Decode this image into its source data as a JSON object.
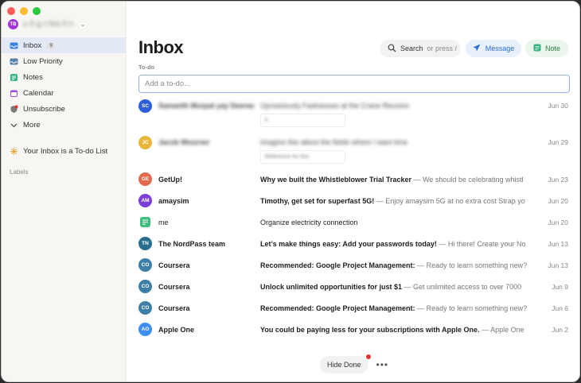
{
  "colors": {
    "accent": "#2c6cd6",
    "note": "#2e7d3d",
    "red_dot": "#e0312b"
  },
  "account": {
    "initials": "TB",
    "name": "u∙ll∙g∙t∙Ma∙ll∙n",
    "avatar_color": "#a334d9"
  },
  "sidebar": {
    "items": [
      {
        "label": "Inbox",
        "badge": "9",
        "icon": "inbox-icon"
      },
      {
        "label": "Low Priority",
        "icon": "low-priority-icon"
      },
      {
        "label": "Notes",
        "icon": "notes-icon"
      },
      {
        "label": "Calendar",
        "icon": "calendar-icon"
      },
      {
        "label": "Unsubscribe",
        "icon": "unsubscribe-icon"
      },
      {
        "label": "More",
        "icon": "chevron-down-icon"
      }
    ],
    "todo_hint": "Your Inbox is a To-do List",
    "labels_heading": "Labels"
  },
  "main": {
    "title": "Inbox",
    "todo_label": "To-do",
    "todo_placeholder": "Add a to-do...",
    "search_label": "Search",
    "search_hint": "or press /",
    "message_label": "Message",
    "note_label": "Note"
  },
  "emails": [
    {
      "initials": "SC",
      "color": "#2c5fd9",
      "sender": "Samanth Murpat yay Deerao",
      "subject": "Uproariously Fastnesses at the Crane Reunion",
      "snippet": "",
      "date": "Jun 30",
      "attachment": "fi"
    },
    {
      "initials": "JC",
      "color": "#e8b63a",
      "sender": "Jacob Mourner",
      "subject": "Imagine this about the fields where I want time",
      "snippet": "",
      "date": "Jun 29",
      "attachment": "Reference for this"
    },
    {
      "initials": "GE",
      "color": "#e26a4e",
      "sender": "GetUp!",
      "subject": "Why we built the Whistleblower Trial Tracker",
      "snippet": "— We should be celebrating whistl",
      "date": "Jun 23"
    },
    {
      "initials": "AM",
      "color": "#7b3fd8",
      "sender": "amaysim",
      "subject": "Timothy, get set for superfast 5G!",
      "snippet": "— Enjoy amaysim 5G at no extra cost Strap yo",
      "date": "Jun 20"
    },
    {
      "initials": "",
      "color": "#3fbf7f",
      "sender": "me",
      "subject": "Organize electricity connection",
      "snippet": "",
      "date": "Jun 20",
      "plain": true
    },
    {
      "initials": "TN",
      "color": "#2a6e8e",
      "sender": "The NordPass team",
      "subject": "Let’s make things easy: Add your passwords today!",
      "snippet": "— Hi there! Create your No",
      "date": "Jun 13"
    },
    {
      "initials": "CO",
      "color": "#3c7ea6",
      "sender": "Coursera",
      "subject": "Recommended: Google Project Management:",
      "snippet": "— Ready to learn something new?",
      "date": "Jun 13"
    },
    {
      "initials": "CO",
      "color": "#3c7ea6",
      "sender": "Coursera",
      "subject": "Unlock unlimited opportunities for just $1",
      "snippet": "— Get unlimited access to over 7000",
      "date": "Jun 9"
    },
    {
      "initials": "CO",
      "color": "#3c7ea6",
      "sender": "Coursera",
      "subject": "Recommended: Google Project Management:",
      "snippet": "— Ready to learn something new?",
      "date": "Jun 6"
    },
    {
      "initials": "AO",
      "color": "#3d8ef0",
      "sender": "Apple One",
      "subject": "You could be paying less for your subscriptions with Apple One.",
      "snippet": "— Apple One",
      "date": "Jun 2"
    }
  ],
  "footer": {
    "hide_done": "Hide Done",
    "more": "•••"
  }
}
